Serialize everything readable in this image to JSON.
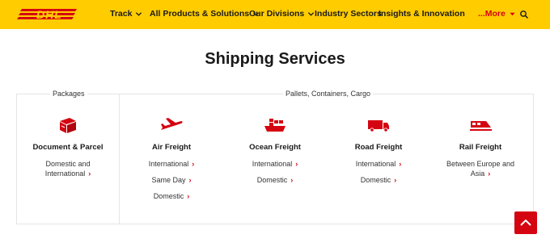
{
  "header": {
    "brand": "DHL",
    "nav": [
      "Track",
      "All Products & Solutions",
      "Our Divisions",
      "Industry Sectors",
      "Insights & Innovation"
    ],
    "more": "...More"
  },
  "main": {
    "title": "Shipping Services",
    "group_packages": "Packages",
    "group_pallets": "Pallets, Containers, Cargo",
    "services": [
      {
        "title": "Document & Parcel",
        "links": [
          "Domestic and International"
        ],
        "icon": "parcel-icon"
      },
      {
        "title": "Air Freight",
        "links": [
          "International",
          "Same Day",
          "Domestic"
        ],
        "icon": "airplane-icon"
      },
      {
        "title": "Ocean Freight",
        "links": [
          "International",
          "Domestic"
        ],
        "icon": "ship-icon"
      },
      {
        "title": "Road Freight",
        "links": [
          "International",
          "Domestic"
        ],
        "icon": "truck-icon"
      },
      {
        "title": "Rail Freight",
        "links": [
          "Between Europe and Asia"
        ],
        "icon": "train-icon"
      }
    ]
  },
  "colors": {
    "brand_yellow": "#ffcc00",
    "brand_red": "#d40511"
  }
}
